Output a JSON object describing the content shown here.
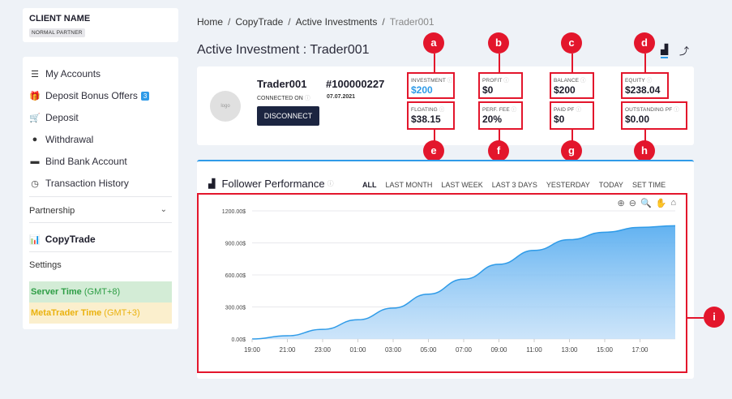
{
  "client": {
    "name": "CLIENT NAME",
    "tier": "NORMAL PARTNER"
  },
  "sidebar": {
    "items": [
      {
        "label": "My Accounts",
        "icon": "list-icon"
      },
      {
        "label": "Deposit Bonus Offers",
        "icon": "gift-icon",
        "badge": "3"
      },
      {
        "label": "Deposit",
        "icon": "cart-icon"
      },
      {
        "label": "Withdrawal",
        "icon": "withdraw-icon"
      },
      {
        "label": "Bind Bank Account",
        "icon": "card-icon"
      },
      {
        "label": "Transaction History",
        "icon": "clock-icon"
      }
    ],
    "partnership": "Partnership",
    "copytrade": "CopyTrade",
    "settings": "Settings",
    "server_time": {
      "label": "Server Time",
      "zone": "(GMT+8)"
    },
    "mt_time": {
      "label": "MetaTrader Time",
      "zone": "(GMT+3)"
    }
  },
  "breadcrumb": [
    "Home",
    "CopyTrade",
    "Active Investments",
    "Trader001"
  ],
  "page_title": "Active Investment : Trader001",
  "trader": {
    "name": "Trader001",
    "id": "#100000227",
    "connected_label": "CONNECTED ON",
    "connected_date": "07.07.2021",
    "disconnect": "DISCONNECT",
    "avatar_text": "logo"
  },
  "stats": [
    {
      "label": "INVESTMENT",
      "value": "$200",
      "marker": "a"
    },
    {
      "label": "PROFIT",
      "value": "$0",
      "marker": "b"
    },
    {
      "label": "BALANCE",
      "value": "$200",
      "marker": "c"
    },
    {
      "label": "EQUITY",
      "value": "$238.04",
      "marker": "d"
    },
    {
      "label": "FLOATING",
      "value": "$38.15",
      "marker": "e"
    },
    {
      "label": "PERF. FEE",
      "value": "20%",
      "marker": "f"
    },
    {
      "label": "PAID PF",
      "value": "$0",
      "marker": "g"
    },
    {
      "label": "OUTSTANDING PF",
      "value": "$0.00",
      "marker": "h"
    }
  ],
  "performance": {
    "title": "Follower Performance",
    "filters": [
      "ALL",
      "LAST MONTH",
      "LAST WEEK",
      "LAST 3 DAYS",
      "YESTERDAY",
      "TODAY",
      "SET TIME"
    ],
    "active_filter": "ALL",
    "marker": "i"
  },
  "colors": {
    "accent": "#2f9be8",
    "annotation": "#e3162c",
    "dark": "#1c2541"
  },
  "chart_data": {
    "type": "area",
    "x": [
      "19:00",
      "21:00",
      "23:00",
      "01:00",
      "03:00",
      "05:00",
      "07:00",
      "09:00",
      "11:00",
      "13:00",
      "15:00",
      "17:00",
      "18:40"
    ],
    "values": [
      0,
      30,
      90,
      180,
      290,
      420,
      560,
      700,
      830,
      930,
      1000,
      1045,
      1060
    ],
    "y_ticks": [
      "0.00$",
      "300.00$",
      "600.00$",
      "900.00$",
      "1200.00$"
    ],
    "x_ticks": [
      "19:00",
      "21:00",
      "23:00",
      "01:00",
      "03:00",
      "05:00",
      "07:00",
      "09:00",
      "11:00",
      "13:00",
      "15:00",
      "17:00"
    ],
    "ylim": [
      0,
      1200
    ],
    "grid": true
  }
}
